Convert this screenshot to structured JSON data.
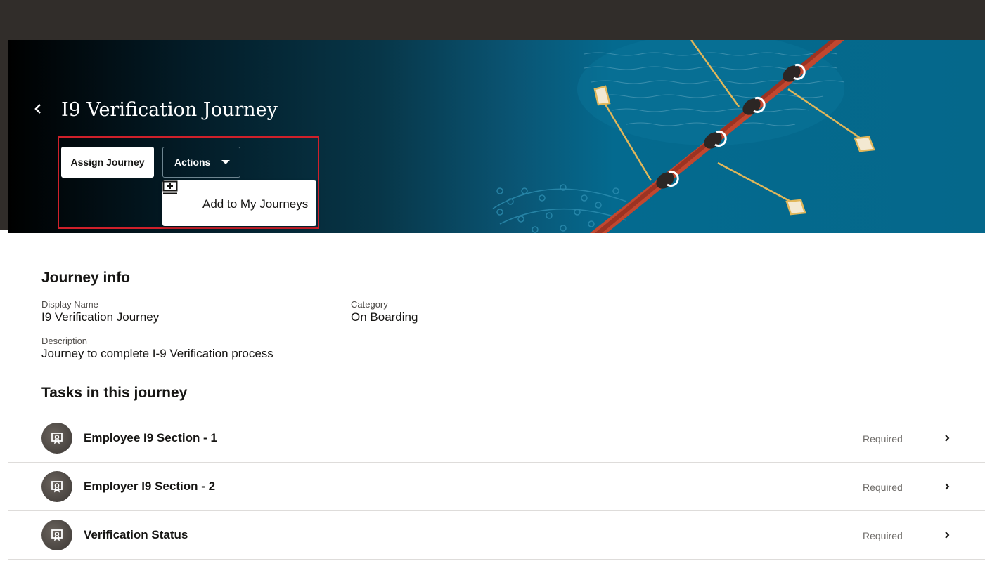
{
  "header": {
    "title": "I9 Verification Journey",
    "back_icon": "chevron-left-icon"
  },
  "toolbar": {
    "assign_label": "Assign Journey",
    "actions_label": "Actions",
    "actions_caret_icon": "caret-down-icon"
  },
  "actions_menu": {
    "items": [
      {
        "label": "Add to My Journeys",
        "icon": "add-to-list-icon"
      }
    ]
  },
  "journey_info": {
    "title": "Journey info",
    "display_name_label": "Display Name",
    "display_name_value": "I9 Verification Journey",
    "category_label": "Category",
    "category_value": "On Boarding",
    "description_label": "Description",
    "description_value": "Journey to complete I-9 Verification process"
  },
  "tasks": {
    "title": "Tasks in this journey",
    "items": [
      {
        "name": "Employee I9 Section - 1",
        "status": "Required"
      },
      {
        "name": "Employer I9 Section - 2",
        "status": "Required"
      },
      {
        "name": "Verification Status",
        "status": "Required"
      }
    ]
  },
  "colors": {
    "top_bar": "#312d2a",
    "hero_blue": "#05688b",
    "highlight": "#d0202a"
  }
}
